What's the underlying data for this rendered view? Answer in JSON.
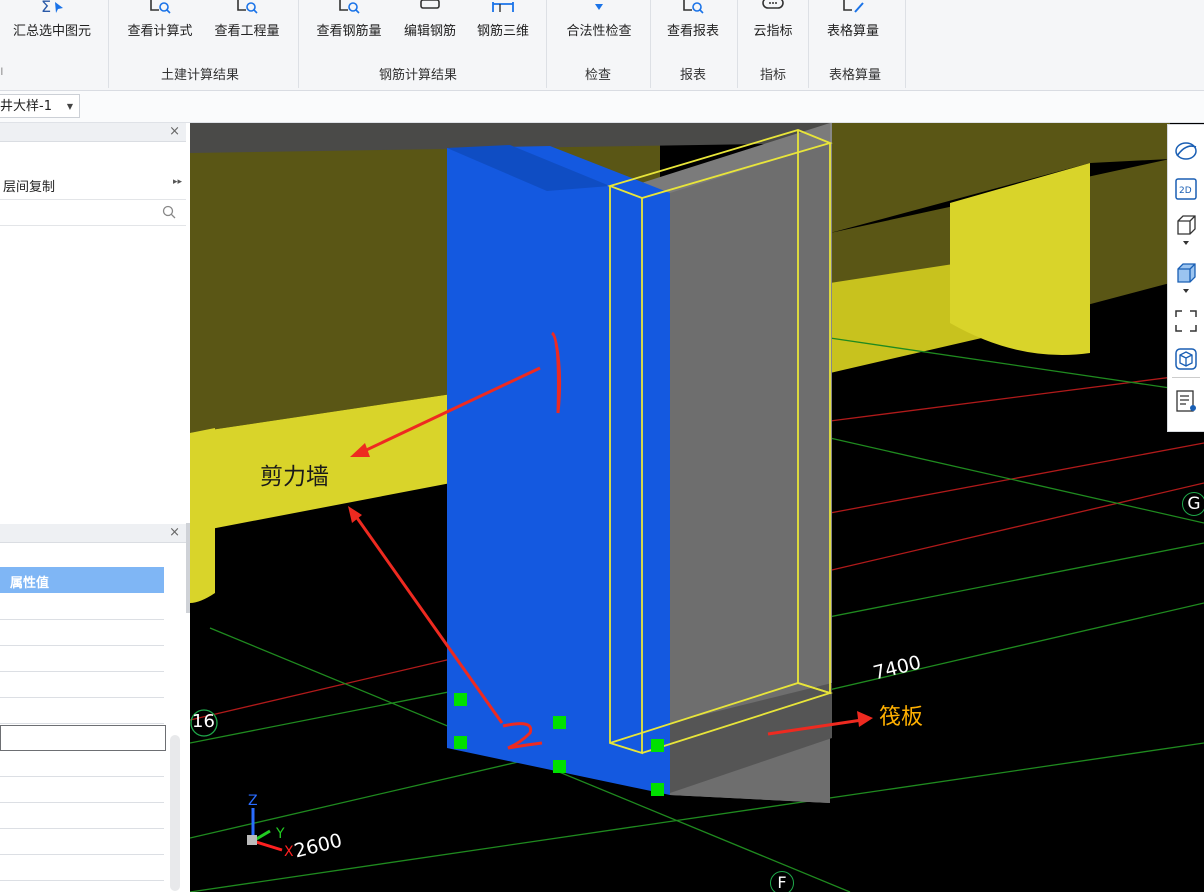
{
  "ribbon": {
    "buttons": [
      {
        "label": "汇总选中图元"
      },
      {
        "label": "查看计算式"
      },
      {
        "label": "查看工程量"
      },
      {
        "label": "查看钢筋量"
      },
      {
        "label": "编辑钢筋"
      },
      {
        "label": "钢筋三维"
      },
      {
        "label": "合法性检查"
      },
      {
        "label": "查看报表"
      },
      {
        "label": "云指标"
      },
      {
        "label": "表格算量"
      }
    ],
    "groups": [
      {
        "label": "土建计算结果"
      },
      {
        "label": "钢筋计算结果"
      },
      {
        "label": "检查"
      },
      {
        "label": "报表"
      },
      {
        "label": "指标"
      },
      {
        "label": "表格算量"
      }
    ]
  },
  "subbar": {
    "combo_value": "井大样-1"
  },
  "left_panel": {
    "floor_copy": "层间复制",
    "property_value_header": "属性值"
  },
  "viewport": {
    "annotation_wall": "剪力墙",
    "annotation_raft": "筏板",
    "mark_1": "1",
    "mark_2": "2",
    "dim_7400": "7400",
    "dim_2600": "2600",
    "axis_g": "G",
    "axis_f": "F",
    "axis_16": "16",
    "gizmo_z": "Z",
    "gizmo_y": "Y",
    "gizmo_x": "X"
  },
  "right_tools": {
    "btn_2d": "2D"
  },
  "colors": {
    "wall_blue": "#1459e0",
    "beam_yellow": "#d9d42a",
    "beam_dark": "#5a5615",
    "grid_green": "#1f8a1f",
    "grid_red": "#b01a1a",
    "annotation_red": "#ee2a20",
    "selection_yellow": "#e8e53a",
    "handle_green": "#00e000"
  }
}
